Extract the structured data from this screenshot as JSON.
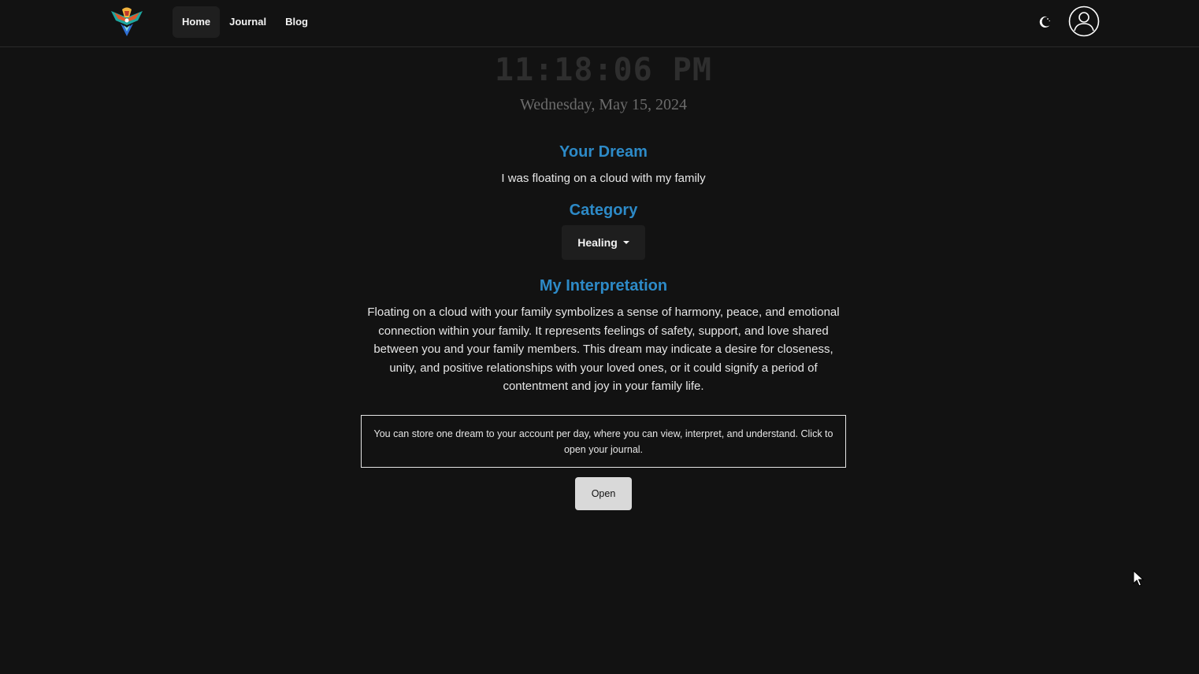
{
  "nav": {
    "links": [
      {
        "label": "Home"
      },
      {
        "label": "Journal"
      },
      {
        "label": "Blog"
      }
    ]
  },
  "clock": {
    "time": "11:18:06 PM",
    "date": "Wednesday, May 15, 2024"
  },
  "dream": {
    "title": "Your Dream",
    "text": "I was floating on a cloud with my family"
  },
  "category": {
    "title": "Category",
    "selected": "Healing"
  },
  "interpretation": {
    "title": "My Interpretation",
    "text": "Floating on a cloud with your family symbolizes a sense of harmony, peace, and emotional connection within your family. It represents feelings of safety, support, and love shared between you and your family members. This dream may indicate a desire for closeness, unity, and positive relationships with your loved ones, or it could signify a period of contentment and joy in your family life."
  },
  "journal": {
    "info": "You can store one dream to your account per day, where you can view, interpret, and understand. Click to open your journal.",
    "open_label": "Open"
  },
  "icons": {
    "logo": "phoenix-logo-icon",
    "theme": "moon-icon",
    "avatar": "user-avatar-icon"
  },
  "colors": {
    "background": "#121212",
    "accent": "#2d8ac7",
    "text": "#e6e6e6"
  }
}
